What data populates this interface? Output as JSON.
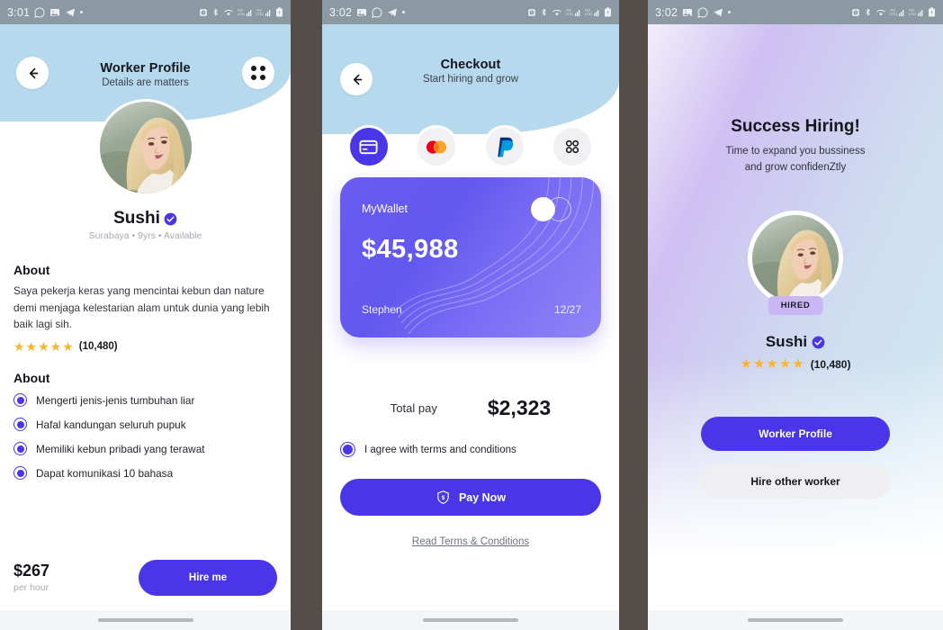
{
  "theme": {
    "accent": "#4a35e8",
    "header_blue": "#b7d9ee",
    "star_yellow": "#f5b731",
    "badge_purple": "#c9b6f5",
    "statusbar_gray": "#8b9aa2"
  },
  "screen1": {
    "status": {
      "time": "3:01",
      "icons": [
        "whatsapp-icon",
        "photos-icon",
        "telegram-icon",
        "dot-icon"
      ],
      "right_icons": [
        "alarm-icon",
        "bluetooth-icon",
        "wifi-icon",
        "signal-volte-1-icon",
        "signal-volte-2-icon",
        "battery-icon"
      ]
    },
    "header": {
      "back": "back-arrow",
      "title": "Worker Profile",
      "subtitle": "Details are matters",
      "menu": "four-dots"
    },
    "profile": {
      "name": "Sushi",
      "verified": true,
      "meta": "Surabaya • 9yrs • Available"
    },
    "about": {
      "title": "About",
      "text": "Saya pekerja keras yang mencintai kebun dan nature demi menjaga kelestarian alam untuk dunia yang lebih baik lagi sih."
    },
    "rating": {
      "stars": 5,
      "stars_glyphs": "★★★★★",
      "count": "(10,480)"
    },
    "skills": {
      "title": "About",
      "items": [
        "Mengerti jenis-jenis tumbuhan liar",
        "Hafal kandungan seluruh pupuk",
        "Memiliki kebun pribadi yang terawat",
        "Dapat komunikasi 10 bahasa"
      ]
    },
    "footer": {
      "price": "$267",
      "price_unit": "per hour",
      "cta": "Hire me"
    }
  },
  "screen2": {
    "status": {
      "time": "3:02"
    },
    "header": {
      "back": "back-arrow",
      "title": "Checkout",
      "subtitle": "Start hiring and grow"
    },
    "payment_methods": [
      {
        "label": "Wallet",
        "icon": "credit-card-icon",
        "selected": true
      },
      {
        "label": "CC",
        "icon": "mastercard-icon",
        "selected": false
      },
      {
        "label": "PayPal",
        "icon": "paypal-icon",
        "selected": false
      },
      {
        "label": "Other",
        "icon": "four-dots-icon",
        "selected": false
      }
    ],
    "card": {
      "name": "MyWallet",
      "amount": "$45,988",
      "holder": "Stephen",
      "expiry": "12/27"
    },
    "total": {
      "label": "Total pay",
      "value": "$2,323"
    },
    "agree": {
      "label": "I agree with terms and conditions",
      "checked": true
    },
    "pay_button": {
      "label": "Pay Now",
      "icon": "shield-dollar-icon"
    },
    "terms_link": "Read Terms & Conditions"
  },
  "screen3": {
    "status": {
      "time": "3:02"
    },
    "title": "Success Hiring!",
    "subtitle": "Time to expand you bussiness\nand grow confidenZtly",
    "subtitle_line1": "Time to expand you bussiness",
    "subtitle_line2": "and grow confidenZtly",
    "badge": "HIRED",
    "profile": {
      "name": "Sushi",
      "verified": true
    },
    "rating": {
      "stars_glyphs": "★★★★★",
      "count": "(10,480)"
    },
    "buttons": {
      "primary": "Worker Profile",
      "secondary": "Hire other worker"
    }
  }
}
